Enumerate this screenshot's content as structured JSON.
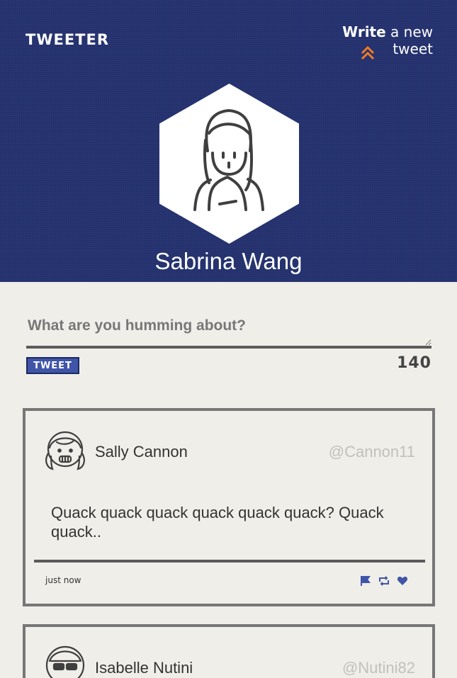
{
  "app": {
    "logo": "TWEETER"
  },
  "header": {
    "compose_word1": "Write",
    "compose_rest": " a new tweet",
    "profile_name": "Sabrina Wang"
  },
  "composer": {
    "placeholder": "What are you humming about?",
    "button_label": "TWEET",
    "char_count": "140"
  },
  "tweets": [
    {
      "name": "Sally Cannon",
      "handle": "@Cannon11",
      "content": "Quack quack quack quack quack quack? Quack quack..",
      "timestamp": "just now",
      "actions": [
        "flag-icon",
        "retweet-icon",
        "heart-icon"
      ]
    },
    {
      "name": "Isabelle Nutini",
      "handle": "@Nutini82"
    }
  ],
  "colors": {
    "header_bg": "#243270",
    "accent": "#f07a25",
    "button": "#4055a8",
    "page_bg": "#f0eee8"
  }
}
